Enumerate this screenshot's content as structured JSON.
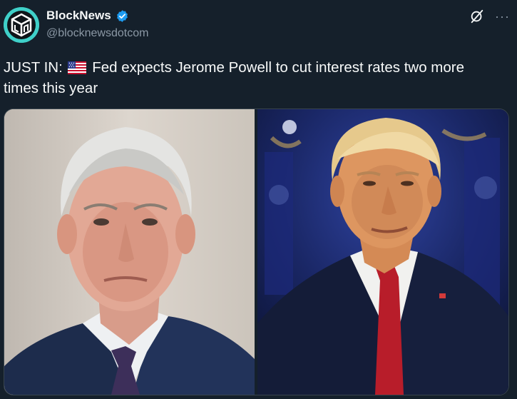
{
  "account": {
    "display_name": "BlockNews",
    "handle": "@blocknewsdotcom",
    "avatar_icon": "blocknews-logo-icon",
    "verified_icon": "verified-badge-icon",
    "verified_color": "#1d9bf0",
    "avatar_color": "#3fd0c9"
  },
  "actions": {
    "grok_icon": "grok-icon",
    "more_icon": "more-icon",
    "more_label": "···"
  },
  "tweet": {
    "prefix": "JUST IN:",
    "flag_icon": "us-flag-icon",
    "body": "Fed expects Jerome Powell to cut interest rates two more times this year"
  },
  "media": {
    "photos": [
      {
        "subject": "portrait-photo-left"
      },
      {
        "subject": "portrait-photo-right"
      }
    ]
  },
  "theme": {
    "background": "#15202b",
    "text": "#f7f9f9",
    "secondary_text": "#8b98a5",
    "border": "#38444d"
  }
}
